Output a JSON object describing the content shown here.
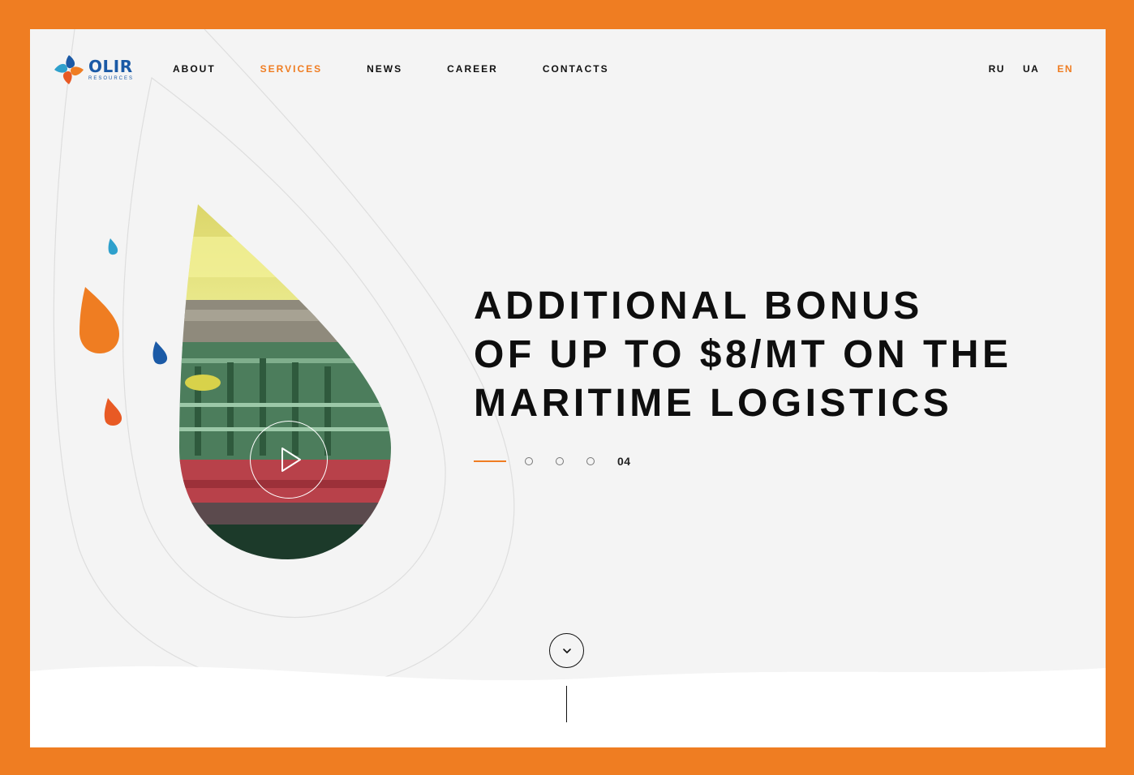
{
  "brand": {
    "name": "OLIR",
    "sub": "RESOURCES",
    "colors": {
      "orange": "#ef7d22",
      "blue": "#1b5aa6",
      "light_blue": "#2ea0cc",
      "red": "#e85a24"
    }
  },
  "nav": {
    "items": [
      {
        "label": "ABOUT",
        "active": false
      },
      {
        "label": "SERVICES",
        "active": true
      },
      {
        "label": "NEWS",
        "active": false
      },
      {
        "label": "CAREER",
        "active": false
      },
      {
        "label": "CONTACTS",
        "active": false
      }
    ]
  },
  "languages": {
    "items": [
      {
        "label": "RU",
        "active": false
      },
      {
        "label": "UA",
        "active": false
      },
      {
        "label": "EN",
        "active": true
      }
    ]
  },
  "hero": {
    "headline": [
      "ADDITIONAL BONUS",
      "OF UP TO $8/MT ON THE",
      "MARITIME LOGISTICS"
    ],
    "slide_number": "04",
    "video_icon": "play-icon",
    "scroll_icon": "chevron-down-icon"
  }
}
